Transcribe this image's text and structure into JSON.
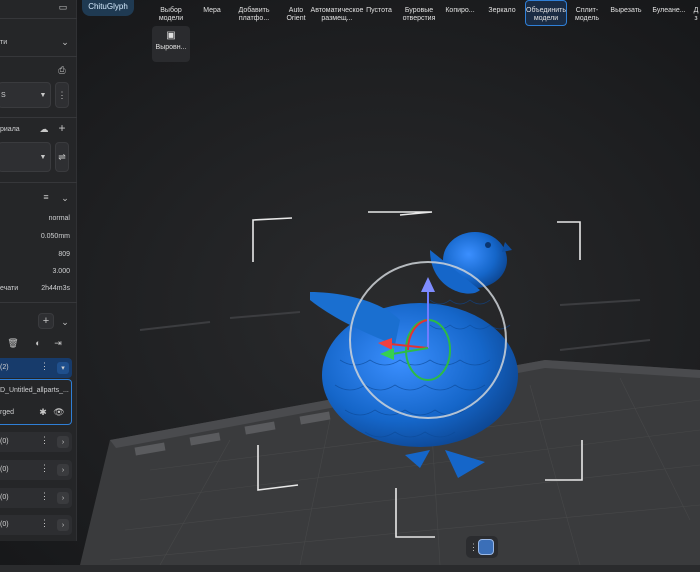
{
  "brand": {
    "label": "ChituGlyph"
  },
  "toolbar": {
    "tools": [
      {
        "label1": "Выбор",
        "label2": "модели",
        "active": false
      },
      {
        "label1": "Мера",
        "label2": "",
        "active": false
      },
      {
        "label1": "Добавить",
        "label2": "платфо...",
        "active": false
      },
      {
        "label1": "Auto",
        "label2": "Orient",
        "active": false
      },
      {
        "label1": "Автоматическое",
        "label2": "размещ...",
        "active": false
      },
      {
        "label1": "Пустота",
        "label2": "",
        "active": false
      },
      {
        "label1": "Буровые",
        "label2": "отверстия",
        "active": false
      },
      {
        "label1": "Копиро...",
        "label2": "",
        "active": false
      },
      {
        "label1": "Зеркало",
        "label2": "",
        "active": false
      },
      {
        "label1": "Объединить",
        "label2": "модели",
        "active": true
      },
      {
        "label1": "Сплит-",
        "label2": "модель",
        "active": false
      },
      {
        "label1": "Вырезать",
        "label2": "",
        "active": false
      },
      {
        "label1": "Булеане...",
        "label2": "",
        "active": false
      },
      {
        "label1": "Д",
        "label2": "з",
        "active": false
      }
    ],
    "align_label": "Выровн..."
  },
  "left_panel": {
    "section_title": "ти",
    "printer_value": "S",
    "material_label": "риала",
    "params": [
      {
        "label": "",
        "value": "normal"
      },
      {
        "label": "",
        "value": "0.050mm"
      },
      {
        "label": "",
        "value": "809"
      },
      {
        "label": "",
        "value": "3.000"
      },
      {
        "label": "ечати",
        "value": "2h44m3s"
      }
    ],
    "objects": [
      {
        "label": "(2)",
        "selected": true
      },
      {
        "label": "D_Untitled_allparts_...",
        "child": true
      },
      {
        "label": "rged",
        "child": true
      },
      {
        "label": "(0)"
      },
      {
        "label": "(0)"
      },
      {
        "label": "(0)"
      },
      {
        "label": "(0)"
      }
    ]
  },
  "colors": {
    "accent": "#2f7fd6",
    "model": "#1a6fd0",
    "panel": "#252628"
  }
}
